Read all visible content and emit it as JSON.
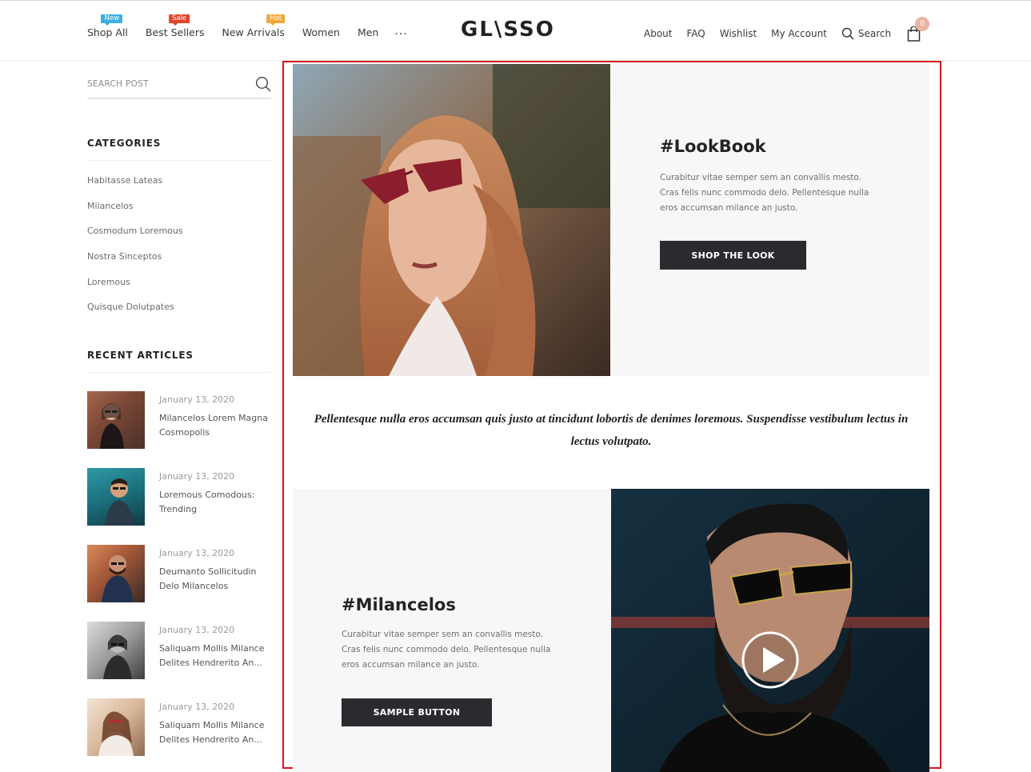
{
  "header": {
    "nav_left": [
      {
        "label": "Shop All",
        "badge": "New",
        "badge_color": "#3ab0e2"
      },
      {
        "label": "Best Sellers",
        "badge": "Sale",
        "badge_color": "#e0442a"
      },
      {
        "label": "New Arrivals",
        "badge": "Hot",
        "badge_color": "#f0a83a"
      },
      {
        "label": "Women"
      },
      {
        "label": "Men"
      },
      {
        "label": "..."
      }
    ],
    "logo": "GL\\SSO",
    "nav_right": [
      "About",
      "FAQ",
      "Wishlist",
      "My Account"
    ],
    "search_label": "Search",
    "cart_count": "0"
  },
  "sidebar": {
    "search_placeholder": "SEARCH POST",
    "categories_heading": "CATEGORIES",
    "categories": [
      "Habitasse Lateas",
      "Milancelos",
      "Cosmodum Loremous",
      "Nostra Sinceptos",
      "Loremous",
      "Quisque Dolutpates"
    ],
    "recent_heading": "RECENT ARTICLES",
    "articles": [
      {
        "date": "January 13, 2020",
        "title": "Milancelos Lorem Magna Cosmopolis"
      },
      {
        "date": "January 13, 2020",
        "title": "Loremous Comodous: Trending"
      },
      {
        "date": "January 13, 2020",
        "title": "Deumanto Sollicitudin Delo Milancelos"
      },
      {
        "date": "January 13, 2020",
        "title": "Saliquam Mollis Milance Delites Hendrerito An..."
      },
      {
        "date": "January 13, 2020",
        "title": "Saliquam Mollis Milance Delites Hendrerito An..."
      }
    ]
  },
  "main": {
    "lookbook": {
      "title": "#LookBook",
      "text": "Curabitur vitae semper sem an convallis mesto. Cras felis nunc commodo delo. Pellentesque nulla eros accumsan milance an justo.",
      "button": "SHOP THE LOOK"
    },
    "quote": "Pellentesque nulla eros accumsan quis justo at tincidunt lobortis de denimes loremous. Suspendisse vestibulum lectus in lectus volutpato.",
    "milancelos": {
      "title": "#Milancelos",
      "text": "Curabitur vitae semper sem an convallis mesto. Cras felis nunc commodo delo. Pellentesque nulla eros accumsan milance an justo.",
      "button": "SAMPLE BUTTON"
    }
  },
  "colors": {
    "accent_dark": "#2a2b2f",
    "highlight_frame": "#d3151c",
    "cart_badge": "#e9b5a3"
  }
}
